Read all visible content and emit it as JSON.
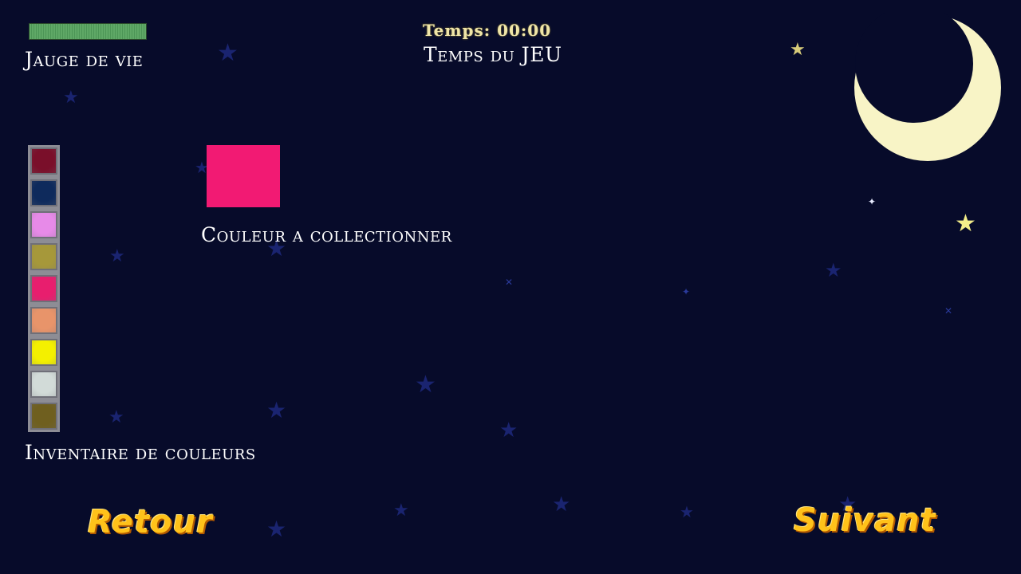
{
  "hud": {
    "health_label": "Jauge de vie",
    "health_level": 1.0,
    "timer_text": "Temps: 00:00",
    "timer_label": "Temps du JEU",
    "target_label": "Couleur a collectionner",
    "inventory_label": "Inventaire de couleurs"
  },
  "colors": {
    "health": "#5fa866",
    "target": "#f21a73",
    "button_text": "#ffc21a",
    "moon": "#f8f4c6"
  },
  "inventory": [
    {
      "color": "#7a0f2a"
    },
    {
      "color": "#0e2a5c"
    },
    {
      "color": "#e78ae8"
    },
    {
      "color": "#a6983a"
    },
    {
      "color": "#e81e6e"
    },
    {
      "color": "#e8946a"
    },
    {
      "color": "#f4f000"
    },
    {
      "color": "#d2dbd8"
    },
    {
      "color": "#6f5f1f"
    }
  ],
  "nav": {
    "back_label": "Retour",
    "next_label": "Suivant"
  }
}
